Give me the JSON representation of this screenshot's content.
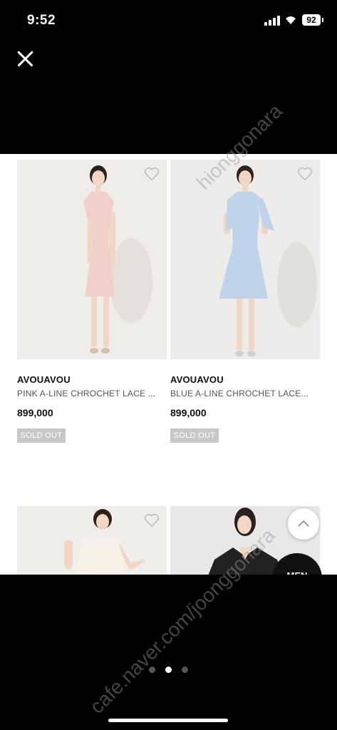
{
  "status_bar": {
    "time": "9:52",
    "battery": "92"
  },
  "products": [
    {
      "brand": "AVOUAVOU",
      "name": "PINK A-LINE CHROCHET LACE ...",
      "price": "899,000",
      "badge": "SOLD OUT",
      "dress_color": "#f2cfca"
    },
    {
      "brand": "AVOUAVOU",
      "name": "BLUE A-LINE CHROCHET LACE...",
      "price": "899,000",
      "badge": "SOLD OUT",
      "dress_color": "#bfd4ea"
    }
  ],
  "menu_button": {
    "label": "MEN"
  },
  "watermark": {
    "text1": "hionggonara",
    "text2": "cafe.naver.com/joonggonara"
  },
  "pager": {
    "count": 3,
    "active": 1
  }
}
